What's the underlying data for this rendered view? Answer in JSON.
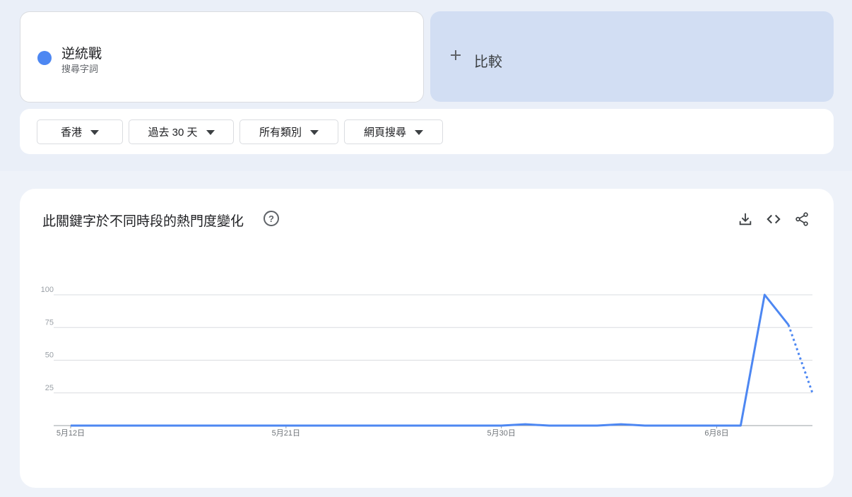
{
  "search_term": {
    "name": "逆統戰",
    "type": "搜尋字詞",
    "color": "#4d87f2"
  },
  "compare": {
    "label": "比較"
  },
  "filters": [
    {
      "label": "香港"
    },
    {
      "label": "過去 30 天"
    },
    {
      "label": "所有類別"
    },
    {
      "label": "網頁搜尋"
    }
  ],
  "chart": {
    "title": "此關鍵字於不同時段的熱門度變化",
    "icons": [
      "help-icon",
      "download-icon",
      "embed-code-icon",
      "share-icon"
    ]
  },
  "chart_data": {
    "type": "line",
    "x": [
      "5月12日",
      "5月13日",
      "5月14日",
      "5月15日",
      "5月16日",
      "5月17日",
      "5月18日",
      "5月19日",
      "5月20日",
      "5月21日",
      "5月22日",
      "5月23日",
      "5月24日",
      "5月25日",
      "5月26日",
      "5月27日",
      "5月28日",
      "5月29日",
      "5月30日",
      "5月31日",
      "6月1日",
      "6月2日",
      "6月3日",
      "6月4日",
      "6月5日",
      "6月6日",
      "6月7日",
      "6月8日",
      "6月9日",
      "6月10日",
      "6月11日",
      "6月12日"
    ],
    "x_tick_labels": [
      "5月12日",
      "5月21日",
      "5月30日",
      "6月8日"
    ],
    "y_ticks": [
      25,
      50,
      75,
      100
    ],
    "ylim": [
      0,
      100
    ],
    "grid": true,
    "series": [
      {
        "name": "逆統戰",
        "color": "#4d87f2",
        "values": [
          0,
          0,
          0,
          0,
          0,
          0,
          0,
          0,
          0,
          0,
          0,
          0,
          0,
          0,
          0,
          0,
          0,
          0,
          0,
          1,
          0,
          0,
          0,
          1,
          0,
          0,
          0,
          0,
          0,
          100,
          77,
          25
        ],
        "partial_from_index": 30
      }
    ]
  }
}
